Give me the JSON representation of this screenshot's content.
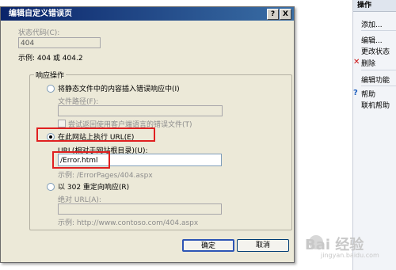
{
  "dialog": {
    "title": "编辑自定义错误页",
    "help_btn": "?",
    "close_btn": "X",
    "status_code_label": "状态代码(C):",
    "status_code_value": "404",
    "example_status": "示例: 404 或 404.2",
    "group_title": "响应操作",
    "opt_static_label": "将静态文件中的内容插入错误响应中(I)",
    "file_path_label": "文件路径(F):",
    "try_lang_label": "尝试返回使用客户端语言的错误文件(T)",
    "opt_execute_label": "在此网站上执行 URL(E)",
    "url_relative_label": "URL(相对于网站根目录)(U):",
    "url_value": "/Error.html",
    "example_url": "示例: /ErrorPages/404.aspx",
    "opt_redirect_label": "以 302 重定向响应(R)",
    "absolute_url_label": "绝对 URL(A):",
    "example_absolute": "示例: http://www.contoso.com/404.aspx",
    "ok_label": "确定",
    "cancel_label": "取消"
  },
  "actions_pane": {
    "header": "操作",
    "items": [
      "添加...",
      "编辑...",
      "更改状态",
      "删除",
      "编辑功能",
      "帮助",
      "联机帮助"
    ]
  },
  "watermark": {
    "text": "Bai 经验",
    "sub": "jingyan.baidu.com"
  },
  "colors": {
    "highlight": "#e02020",
    "titlebar": "#0a246a",
    "dialog_bg": "#ece9d8"
  }
}
